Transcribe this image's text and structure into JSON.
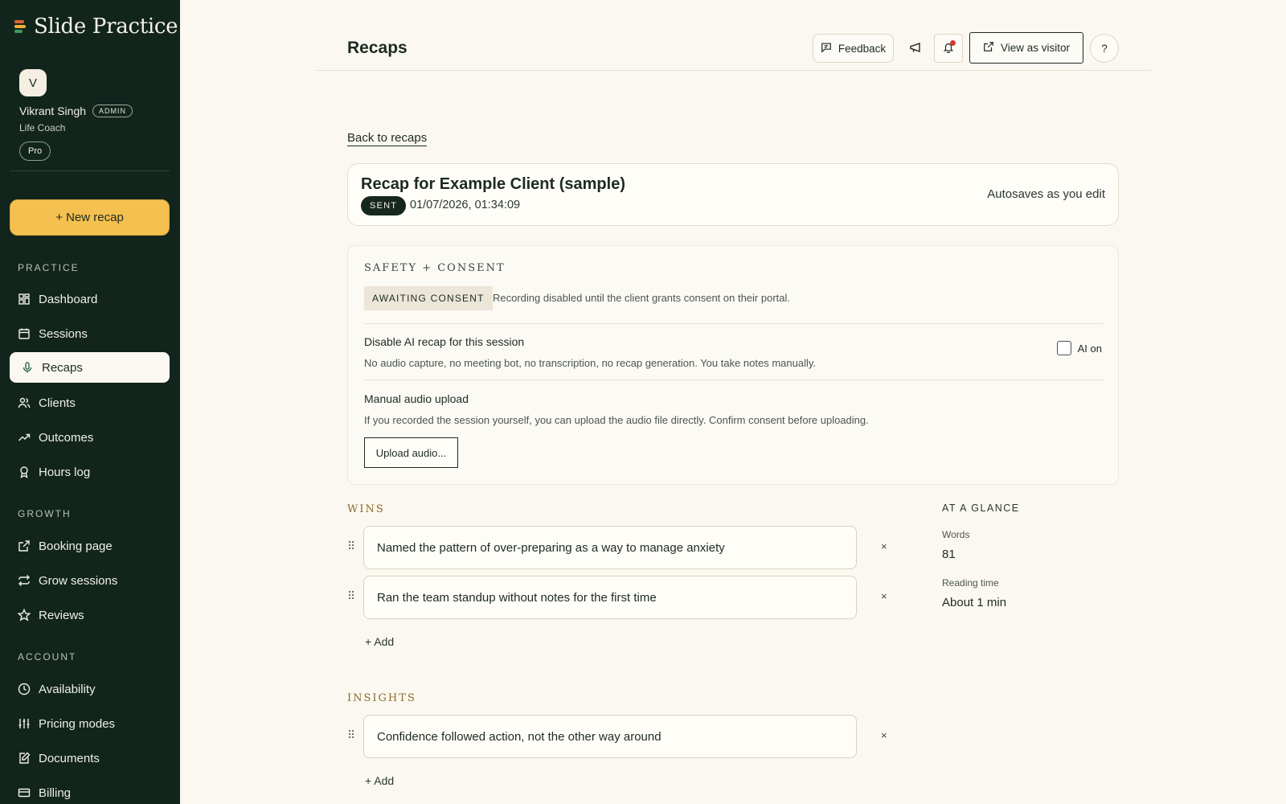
{
  "app": {
    "name": "Slide Practice",
    "brand_colors": [
      "#e0623a",
      "#f2b035",
      "#3f9a5b"
    ]
  },
  "user": {
    "initial": "V",
    "name": "Vikrant Singh",
    "badge": "ADMIN",
    "role": "Life Coach",
    "plan": "Pro"
  },
  "sidebar": {
    "new_button": "+ New recap",
    "sections": [
      {
        "label": "PRACTICE",
        "items": [
          {
            "label": "Dashboard",
            "icon": "grid-icon"
          },
          {
            "label": "Sessions",
            "icon": "calendar-icon"
          },
          {
            "label": "Recaps",
            "icon": "microphone-icon",
            "active": true
          },
          {
            "label": "Clients",
            "icon": "users-icon"
          },
          {
            "label": "Outcomes",
            "icon": "trend-icon"
          },
          {
            "label": "Hours log",
            "icon": "badge-icon"
          }
        ]
      },
      {
        "label": "GROWTH",
        "items": [
          {
            "label": "Booking page",
            "icon": "external-link-icon"
          },
          {
            "label": "Grow sessions",
            "icon": "repeat-icon"
          },
          {
            "label": "Reviews",
            "icon": "star-icon"
          }
        ]
      },
      {
        "label": "ACCOUNT",
        "items": [
          {
            "label": "Availability",
            "icon": "clock-icon"
          },
          {
            "label": "Pricing modes",
            "icon": "sliders-icon"
          },
          {
            "label": "Documents",
            "icon": "document-edit-icon"
          },
          {
            "label": "Billing",
            "icon": "credit-card-icon"
          }
        ]
      }
    ]
  },
  "header": {
    "title": "Recaps",
    "feedback": "Feedback",
    "view_as_visitor": "View as visitor",
    "help": "?"
  },
  "recap": {
    "back_link": "Back to recaps",
    "title": "Recap for Example Client (sample)",
    "status": "SENT",
    "datetime": "01/07/2026, 01:34:09",
    "autosave": "Autosaves as you edit"
  },
  "safety": {
    "label": "SAFETY + CONSENT",
    "consent_status": "AWAITING CONSENT",
    "consent_note": "Recording disabled until the client grants consent on their portal.",
    "disable_title": "Disable AI recap for this session",
    "disable_desc": "No audio capture, no meeting bot, no transcription, no recap generation. You take notes manually.",
    "ai_toggle_label": "AI on",
    "ai_disabled_checked": false,
    "upload_title": "Manual audio upload",
    "upload_desc": "If you recorded the session yourself, you can upload the audio file directly. Confirm consent before uploading.",
    "upload_button": "Upload audio..."
  },
  "wins": {
    "heading": "WINS",
    "items": [
      "Named the pattern of over-preparing as a way to manage anxiety",
      "Ran the team standup without notes for the first time"
    ],
    "add": "+ Add"
  },
  "insights": {
    "heading": "INSIGHTS",
    "items": [
      "Confidence followed action, not the other way around"
    ],
    "add": "+ Add"
  },
  "glance": {
    "title": "AT A GLANCE",
    "words_label": "Words",
    "words_value": "81",
    "reading_label": "Reading time",
    "reading_value": "About 1 min"
  },
  "remove_glyph": "×",
  "drag_glyph": "⠿"
}
